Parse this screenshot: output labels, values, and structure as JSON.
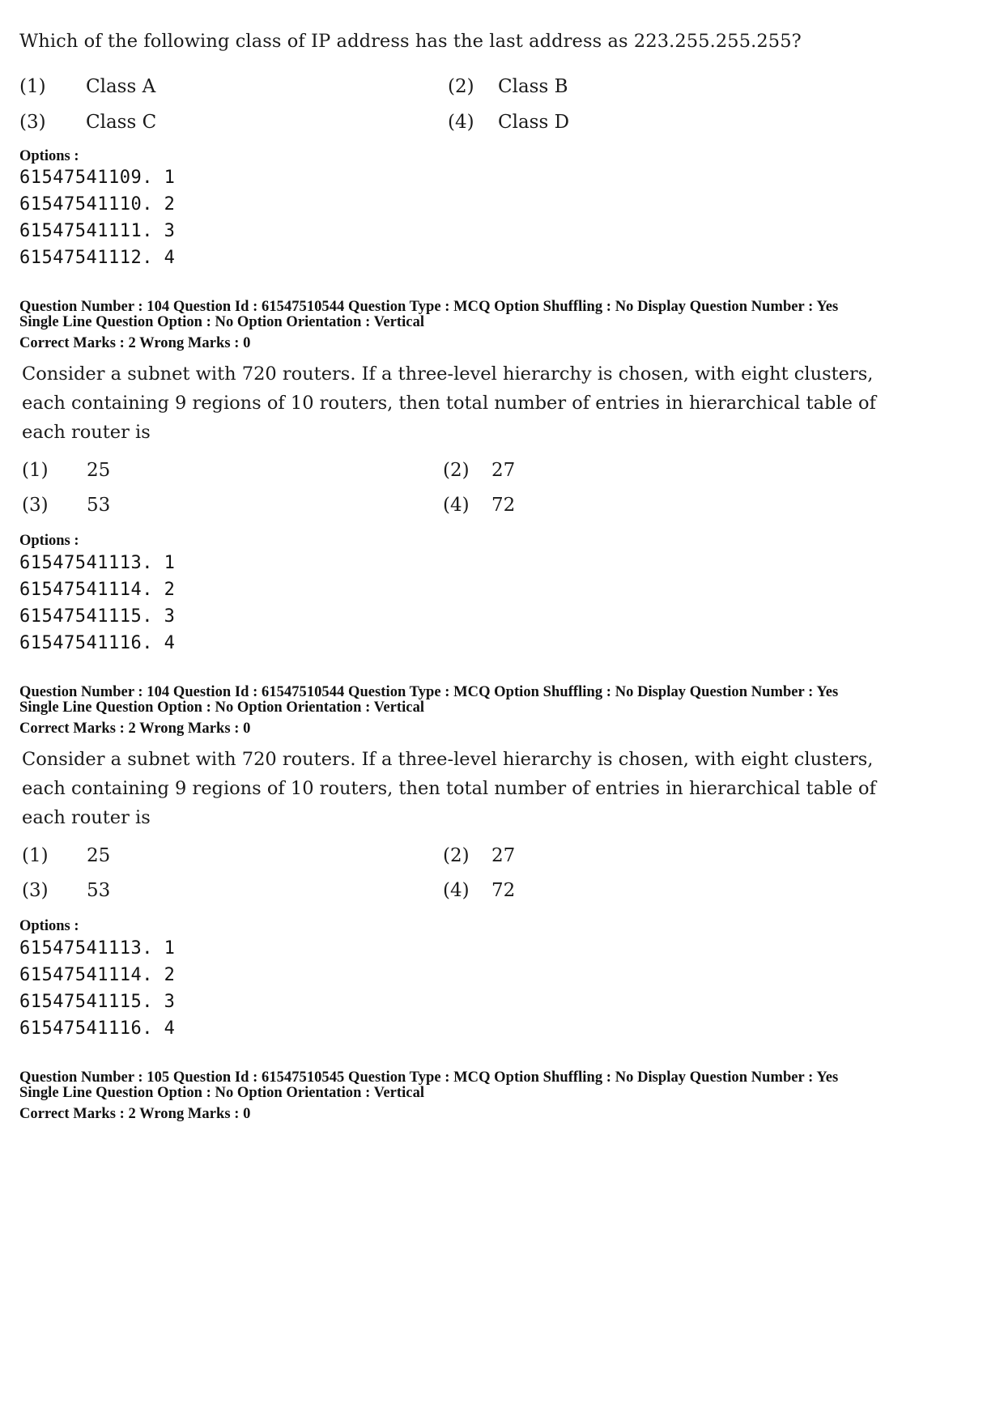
{
  "blocks": [
    {
      "question_text": "Which of the following class of IP address has the last address as 223.255.255.255?",
      "choices": [
        {
          "num": "(1)",
          "text": "Class A"
        },
        {
          "num": "(2)",
          "text": "Class B"
        },
        {
          "num": "(3)",
          "text": "Class C"
        },
        {
          "num": "(4)",
          "text": "Class D"
        }
      ],
      "options_label": "Options :",
      "option_codes": [
        "61547541109. 1",
        "61547541110. 2",
        "61547541111. 3",
        "61547541112. 4"
      ]
    },
    {
      "meta_line1": "Question Number : 104  Question Id : 61547510544  Question Type : MCQ  Option Shuffling : No  Display Question Number : Yes",
      "meta_line2": "Single Line Question Option : No  Option Orientation : Vertical",
      "marks_line": "Correct Marks : 2  Wrong Marks : 0",
      "question_lines": [
        "Consider a subnet with 720 routers. If a three-level hierarchy is chosen, with eight clusters,",
        "each containing 9 regions of 10 routers, then total number of entries in hierarchical table of",
        "each router is"
      ],
      "choices": [
        {
          "num": "(1)",
          "text": "25"
        },
        {
          "num": "(2)",
          "text": "27"
        },
        {
          "num": "(3)",
          "text": "53"
        },
        {
          "num": "(4)",
          "text": "72"
        }
      ],
      "options_label": "Options :",
      "option_codes": [
        "61547541113. 1",
        "61547541114. 2",
        "61547541115. 3",
        "61547541116. 4"
      ]
    },
    {
      "meta_line1": "Question Number : 104  Question Id : 61547510544  Question Type : MCQ  Option Shuffling : No  Display Question Number : Yes",
      "meta_line2": "Single Line Question Option : No  Option Orientation : Vertical",
      "marks_line": "Correct Marks : 2  Wrong Marks : 0",
      "question_lines": [
        "Consider a subnet with 720 routers. If a three-level hierarchy is chosen, with eight clusters,",
        "each containing 9 regions of 10 routers, then total number of entries in hierarchical table of",
        "each router is"
      ],
      "choices": [
        {
          "num": "(1)",
          "text": "25"
        },
        {
          "num": "(2)",
          "text": "27"
        },
        {
          "num": "(3)",
          "text": "53"
        },
        {
          "num": "(4)",
          "text": "72"
        }
      ],
      "options_label": "Options :",
      "option_codes": [
        "61547541113. 1",
        "61547541114. 2",
        "61547541115. 3",
        "61547541116. 4"
      ]
    },
    {
      "meta_line1": "Question Number : 105  Question Id : 61547510545  Question Type : MCQ  Option Shuffling : No  Display Question Number : Yes",
      "meta_line2": "Single Line Question Option : No  Option Orientation : Vertical",
      "marks_line": "Correct Marks : 2  Wrong Marks : 0"
    }
  ]
}
